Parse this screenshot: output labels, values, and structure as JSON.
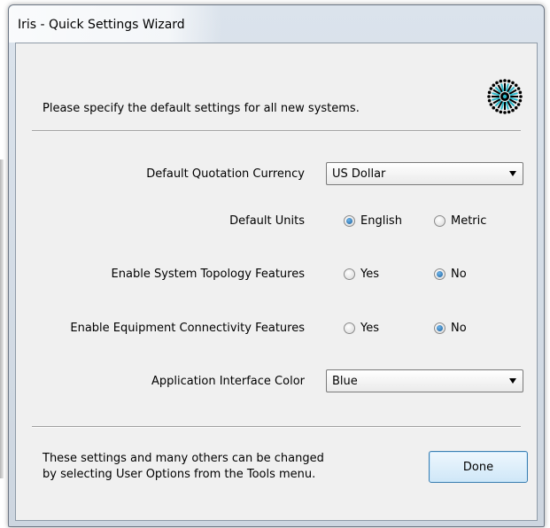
{
  "window": {
    "title": "Iris - Quick Settings Wizard"
  },
  "intro_text": "Please specify the default settings for all new systems.",
  "logo_icon": "iris-logo-icon",
  "fields": {
    "currency": {
      "label": "Default Quotation Currency",
      "value": "US Dollar"
    },
    "units": {
      "label": "Default Units",
      "options": [
        "English",
        "Metric"
      ],
      "selected": "English"
    },
    "topology": {
      "label": "Enable System Topology Features",
      "options": [
        "Yes",
        "No"
      ],
      "selected": "No"
    },
    "connectivity": {
      "label": "Enable Equipment Connectivity Features",
      "options": [
        "Yes",
        "No"
      ],
      "selected": "No"
    },
    "color": {
      "label": "Application Interface Color",
      "value": "Blue"
    }
  },
  "footer": {
    "line1": "These settings and many others can be changed",
    "line2": "by selecting User Options from the Tools menu.",
    "done_label": "Done"
  },
  "colors": {
    "accent": "#1b5f9c",
    "button_border": "#3c7fb1",
    "dialog_bg": "#f0f0f0"
  }
}
